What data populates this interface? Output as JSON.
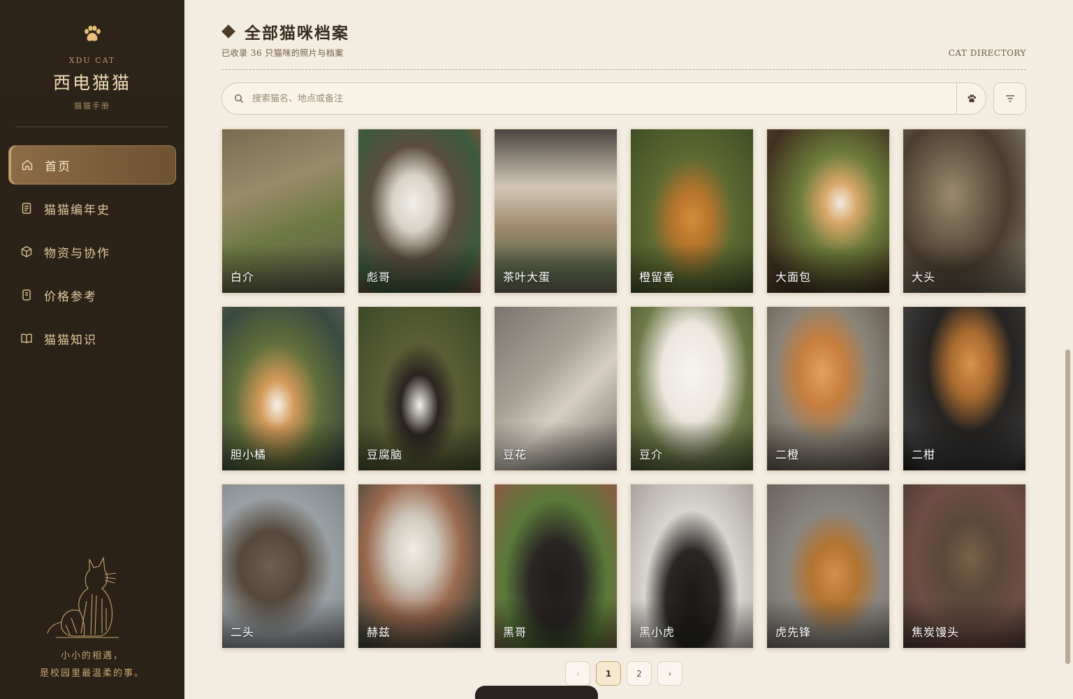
{
  "sidebar": {
    "brand_en": "XDU CAT",
    "brand_cn": "西电猫猫",
    "brand_sub": "猫猫手册",
    "nav": [
      {
        "label": "首页",
        "icon": "home-icon",
        "active": true
      },
      {
        "label": "猫猫编年史",
        "icon": "document-icon",
        "active": false
      },
      {
        "label": "物资与协作",
        "icon": "box-icon",
        "active": false
      },
      {
        "label": "价格参考",
        "icon": "receipt-icon",
        "active": false
      },
      {
        "label": "猫猫知识",
        "icon": "book-icon",
        "active": false
      }
    ],
    "tagline_1": "小小的相遇，",
    "tagline_2": "是校园里最温柔的事。"
  },
  "header": {
    "title": "全部猫咪档案",
    "subtitle": "已收录 36 只猫咪的照片与档案",
    "directory_label": "CAT DIRECTORY"
  },
  "search": {
    "placeholder": "搜索猫名、地点或备注",
    "value": ""
  },
  "cats": [
    {
      "name": "白介"
    },
    {
      "name": "彪哥"
    },
    {
      "name": "茶叶大蛋"
    },
    {
      "name": "橙留香"
    },
    {
      "name": "大面包"
    },
    {
      "name": "大头"
    },
    {
      "name": "胆小橘"
    },
    {
      "name": "豆腐脑"
    },
    {
      "name": "豆花"
    },
    {
      "name": "豆介"
    },
    {
      "name": "二橙"
    },
    {
      "name": "二柑"
    },
    {
      "name": "二头"
    },
    {
      "name": "赫兹"
    },
    {
      "name": "黑哥"
    },
    {
      "name": "黑小虎"
    },
    {
      "name": "虎先锋"
    },
    {
      "name": "焦炭馒头"
    }
  ],
  "pagination": {
    "prev": "‹",
    "pages": [
      "1",
      "2"
    ],
    "current": "1",
    "next": "›"
  },
  "colors": {
    "sidebar_bg": "#2a2117",
    "accent": "#c9a46c",
    "page_bg": "#f3ece0"
  }
}
